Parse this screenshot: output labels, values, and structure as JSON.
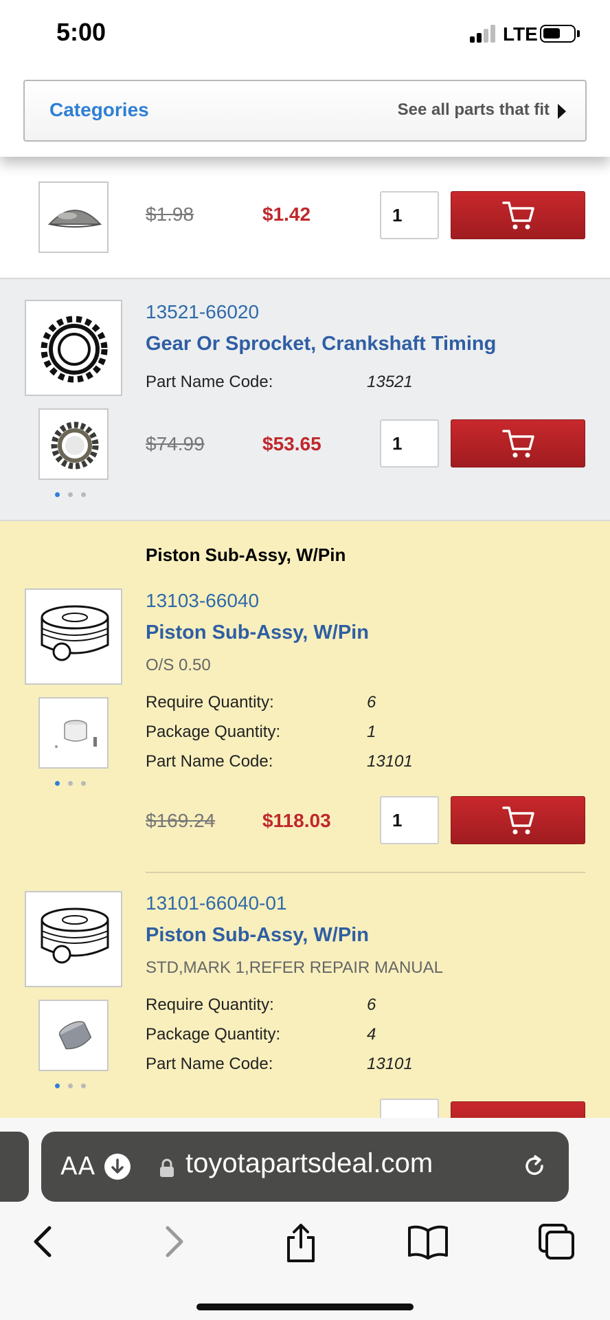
{
  "status": {
    "time": "5:00",
    "network": "LTE"
  },
  "nav": {
    "categories": "Categories",
    "see_all": "See all parts that fit"
  },
  "rows": [
    {
      "old_price": "$1.98",
      "new_price": "$1.42",
      "qty": "1"
    },
    {
      "part_number": "13521-66020",
      "title": "Gear Or Sprocket, Crankshaft Timing",
      "specs": [
        {
          "label": "Part Name Code:",
          "value": "13521"
        }
      ],
      "old_price": "$74.99",
      "new_price": "$53.65",
      "qty": "1"
    }
  ],
  "group": {
    "title": "Piston Sub-Assy, W/Pin",
    "items": [
      {
        "part_number": "13103-66040",
        "title": "Piston Sub-Assy, W/Pin",
        "subtitle": "O/S 0.50",
        "specs": [
          {
            "label": "Require Quantity:",
            "value": "6"
          },
          {
            "label": "Package Quantity:",
            "value": "1"
          },
          {
            "label": "Part Name Code:",
            "value": "13101"
          }
        ],
        "old_price": "$169.24",
        "new_price": "$118.03",
        "qty": "1"
      },
      {
        "part_number": "13101-66040-01",
        "title": "Piston Sub-Assy, W/Pin",
        "subtitle": "STD,MARK 1,REFER REPAIR MANUAL",
        "specs": [
          {
            "label": "Require Quantity:",
            "value": "6"
          },
          {
            "label": "Package Quantity:",
            "value": "4"
          },
          {
            "label": "Part Name Code:",
            "value": "13101"
          }
        ]
      }
    ]
  },
  "browser": {
    "aa": "AA",
    "url": "toyotapartsdeal.com"
  },
  "colors": {
    "accent_blue": "#2f7fd6",
    "price_red": "#c0282c",
    "highlight_yellow": "#f8efbd"
  },
  "icons": [
    "cart-icon",
    "lock-icon",
    "reload-icon",
    "download-icon",
    "back-icon",
    "forward-icon",
    "share-icon",
    "bookmarks-icon",
    "tabs-icon"
  ]
}
